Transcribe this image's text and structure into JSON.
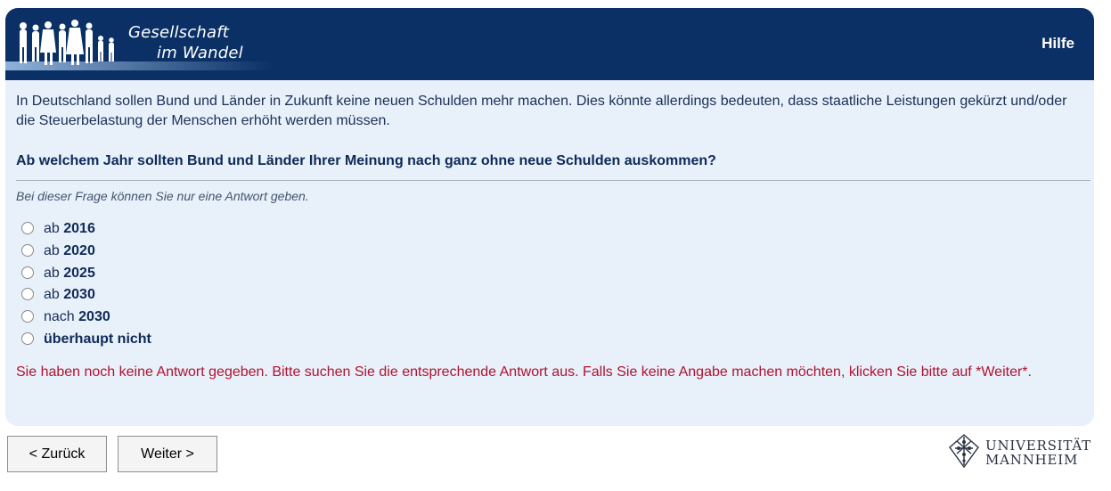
{
  "header": {
    "logo_line1": "Gesellschaft",
    "logo_line2": "im Wandel",
    "help_label": "Hilfe"
  },
  "intro_text": "In Deutschland sollen Bund und Länder in Zukunft keine neuen Schulden mehr machen. Dies könnte allerdings bedeuten, dass staatliche Leistungen gekürzt und/oder die Steuerbelastung der Menschen erhöht werden müssen.",
  "question": "Ab welchem Jahr sollten Bund und Länder Ihrer Meinung nach ganz ohne neue Schulden auskommen?",
  "instruction": "Bei dieser Frage können Sie nur eine Antwort geben.",
  "options": [
    {
      "prefix": "ab ",
      "value": "2016",
      "selected": false
    },
    {
      "prefix": "ab ",
      "value": "2020",
      "selected": false
    },
    {
      "prefix": "ab ",
      "value": "2025",
      "selected": false
    },
    {
      "prefix": "ab ",
      "value": "2030",
      "selected": false
    },
    {
      "prefix": "nach ",
      "value": "2030",
      "selected": false
    },
    {
      "prefix": "",
      "value": "überhaupt nicht",
      "selected": false
    }
  ],
  "error_message": "Sie haben noch keine Antwort gegeben. Bitte suchen Sie die entsprechende Antwort aus. Falls Sie keine Angabe machen möchten, klicken Sie bitte auf *Weiter*.",
  "nav": {
    "back_label": "< Zurück",
    "next_label": "Weiter >"
  },
  "university": {
    "line1": "UNIVERSITÄT",
    "line2": "MANNHEIM"
  },
  "colors": {
    "header_bg": "#0b3065",
    "panel_bg": "#e8f0fa",
    "error_text": "#b0122f",
    "question_text": "#0e2a57"
  }
}
